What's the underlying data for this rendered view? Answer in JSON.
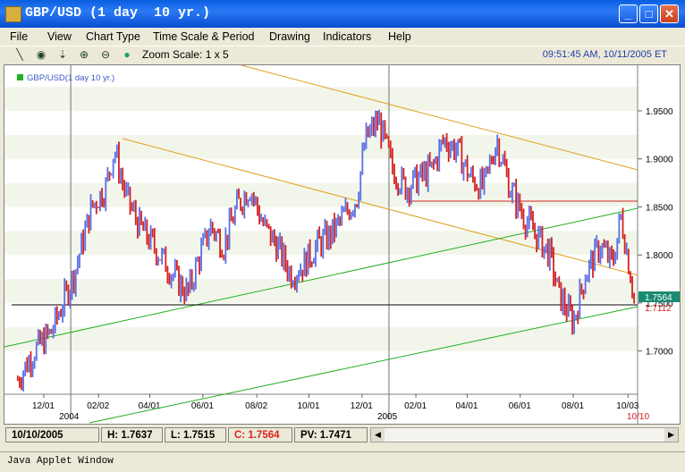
{
  "window": {
    "title": "GBP/USD (1 day  10 yr.)",
    "minimize": "_",
    "maximize": "□",
    "close": "✕"
  },
  "menu": [
    "File",
    "View",
    "Chart Type",
    "Time Scale & Period",
    "Drawing",
    "Indicators",
    "Help"
  ],
  "toolbar": {
    "icons": [
      "line-draw-icon",
      "target-icon",
      "cursor-split-icon",
      "zoom-in-icon",
      "zoom-out-icon",
      "status-dot-icon"
    ],
    "zoom_scale": "Zoom Scale: 1 x 5",
    "timestamp": "09:51:45 AM, 10/11/2005 ET"
  },
  "chart_data": {
    "type": "line",
    "legend": "GBP/USD(1 day  10 yr.)",
    "x_tick_labels": [
      "12/01",
      "02/02",
      "04/01",
      "06/01",
      "08/02",
      "10/01",
      "12/01",
      "02/01",
      "04/01",
      "06/01",
      "08/01",
      "10/03"
    ],
    "year_labels": [
      "2004",
      "2005"
    ],
    "y_tick_labels": [
      "1.9500",
      "1.9000",
      "1.8500",
      "1.8000",
      "1.7500",
      "1.7000"
    ],
    "ylim": [
      1.655,
      1.99
    ],
    "current_price_label": "1.7564",
    "secondary_price_label": "1.7112",
    "end_date_label": "10/10",
    "series": [
      {
        "x": [
          "2003-11-01",
          "2003-11-20",
          "2003-12-10",
          "2004-01-05",
          "2004-01-25",
          "2004-02-10",
          "2004-02-20",
          "2004-03-05",
          "2004-03-20",
          "2004-04-05",
          "2004-04-20",
          "2004-05-05",
          "2004-05-15",
          "2004-05-25",
          "2004-06-10",
          "2004-06-25",
          "2004-07-10",
          "2004-07-25",
          "2004-08-10",
          "2004-08-25",
          "2004-09-10",
          "2004-09-25",
          "2004-10-10",
          "2004-10-25",
          "2004-11-10",
          "2004-11-25",
          "2004-12-05",
          "2004-12-20",
          "2005-01-05",
          "2005-01-20",
          "2005-02-05",
          "2005-02-20",
          "2005-03-05",
          "2005-03-20",
          "2005-04-05",
          "2005-04-20",
          "2005-05-05",
          "2005-05-20",
          "2005-06-05",
          "2005-06-20",
          "2005-07-05",
          "2005-07-15",
          "2005-08-01",
          "2005-08-15",
          "2005-09-01",
          "2005-09-15",
          "2005-09-25",
          "2005-10-10"
        ],
        "y": [
          1.67,
          1.7,
          1.72,
          1.78,
          1.85,
          1.87,
          1.91,
          1.86,
          1.83,
          1.81,
          1.79,
          1.77,
          1.76,
          1.79,
          1.83,
          1.81,
          1.85,
          1.87,
          1.83,
          1.81,
          1.78,
          1.79,
          1.81,
          1.82,
          1.84,
          1.86,
          1.92,
          1.94,
          1.89,
          1.87,
          1.88,
          1.89,
          1.92,
          1.91,
          1.88,
          1.87,
          1.92,
          1.87,
          1.84,
          1.82,
          1.8,
          1.76,
          1.73,
          1.78,
          1.81,
          1.79,
          1.84,
          1.7564
        ]
      }
    ],
    "grid": true
  },
  "status": {
    "date": "10/10/2005",
    "high": "H: 1.7637",
    "low": "L: 1.7515",
    "close": "C: 1.7564",
    "pv": "PV: 1.7471"
  },
  "scrollbar": {
    "left": "◀",
    "right": "▶"
  },
  "applet": "Java Applet Window",
  "colors": {
    "up_bar": "#5b6fe6",
    "down_bar": "#d62020",
    "title_blue": "#0a5fe0",
    "trend_green": "#20b020",
    "trend_orange": "#e0a020",
    "hline_red": "#d02020",
    "price_box": "#1a8a70"
  }
}
